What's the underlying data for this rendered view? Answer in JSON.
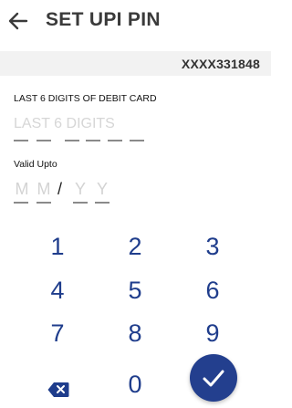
{
  "header": {
    "title": "SET UPI PIN",
    "back_icon": "arrow-left-icon"
  },
  "account": {
    "masked_number": "XXXX331848"
  },
  "card_field": {
    "label": "LAST 6 DIGITS OF DEBIT CARD",
    "placeholder": "LAST 6 DIGITS",
    "value": ""
  },
  "validity_field": {
    "label": "Valid Upto",
    "month_placeholder": [
      "M",
      "M"
    ],
    "separator": "/",
    "year_placeholder": [
      "Y",
      "Y"
    ]
  },
  "keypad": {
    "keys": [
      "1",
      "2",
      "3",
      "4",
      "5",
      "6",
      "7",
      "8",
      "9",
      "0"
    ],
    "backspace_icon": "backspace-icon",
    "submit_icon": "checkmark-icon"
  },
  "colors": {
    "keypad_text": "#1f3d8c",
    "submit_button": "#233f8e",
    "account_bar": "#f2f2f2"
  }
}
